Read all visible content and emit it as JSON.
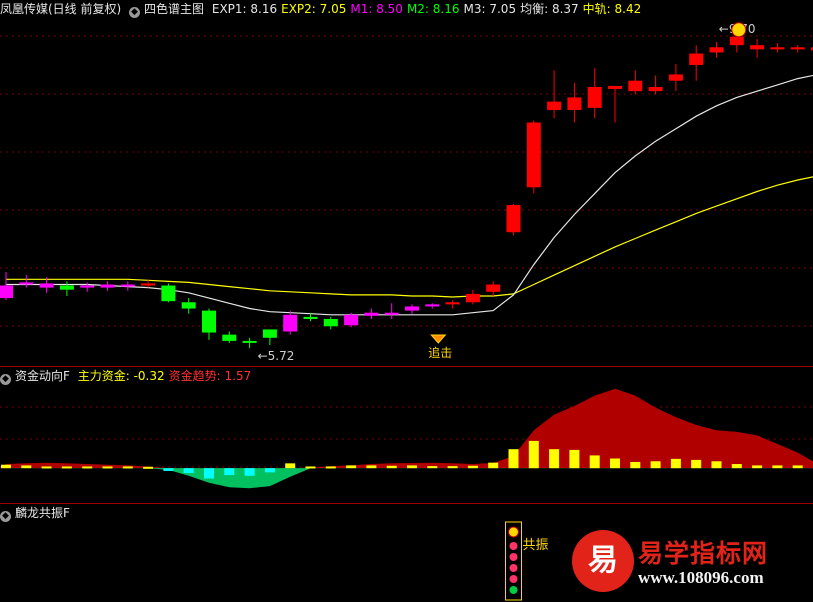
{
  "main_header": {
    "title": "凤凰传媒(日线 前复权)",
    "indicator_name": "四色谱主图",
    "items": [
      {
        "label": "EXP1: 8.16",
        "color": "#e6e6e6"
      },
      {
        "label": "EXP2: 7.05",
        "color": "#ffff00"
      },
      {
        "label": "M1: 8.50",
        "color": "#ff00ff"
      },
      {
        "label": "M2: 8.16",
        "color": "#00ff00"
      },
      {
        "label": "M3: 7.05",
        "color": "#e6e6e6"
      },
      {
        "label": "均衡: 8.37",
        "color": "#e6e6e6"
      },
      {
        "label": "中轨: 8.42",
        "color": "#ffff00"
      }
    ]
  },
  "money_header": {
    "title": "资金动向F",
    "items": [
      {
        "label": "主力资金: -0.32",
        "color": "#ffff00"
      },
      {
        "label": "资金趋势: 1.57",
        "color": "#ff3030"
      }
    ]
  },
  "resonance_header": {
    "title": "麟龙共振F"
  },
  "annotations": {
    "high_label": "9.70",
    "low_label": "5.72",
    "chase_label": "追击",
    "resonance_label": "共振"
  },
  "colors": {
    "up": "#ff0000",
    "down": "#00ff00",
    "magenta": "#ff00ff",
    "exp1": "#e6e6e6",
    "exp2": "#ffff00",
    "trend_fill": "#b00000",
    "money_pos": "#ffff00",
    "money_neg": "#00ffff",
    "money_area_neg": "#00c060"
  },
  "logo": {
    "title": "易学指标网",
    "url": "www.108096.com",
    "mark": "易"
  },
  "chart_data": [
    {
      "type": "candlestick",
      "title": "凤凰传媒(日线 前复权)",
      "candles": [
        {
          "o": 7.32,
          "h": 7.45,
          "l": 7.18,
          "c": 7.2,
          "color": "magenta"
        },
        {
          "o": 7.35,
          "h": 7.42,
          "l": 7.3,
          "c": 7.33,
          "color": "magenta"
        },
        {
          "o": 7.3,
          "h": 7.4,
          "l": 7.25,
          "c": 7.34,
          "color": "magenta"
        },
        {
          "o": 7.32,
          "h": 7.36,
          "l": 7.22,
          "c": 7.28,
          "color": "down"
        },
        {
          "o": 7.3,
          "h": 7.35,
          "l": 7.26,
          "c": 7.32,
          "color": "magenta"
        },
        {
          "o": 7.33,
          "h": 7.36,
          "l": 7.27,
          "c": 7.3,
          "color": "magenta"
        },
        {
          "o": 7.31,
          "h": 7.36,
          "l": 7.27,
          "c": 7.33,
          "color": "magenta"
        },
        {
          "o": 7.34,
          "h": 7.38,
          "l": 7.3,
          "c": 7.32,
          "color": "up"
        },
        {
          "o": 7.32,
          "h": 7.34,
          "l": 7.16,
          "c": 7.17,
          "color": "down"
        },
        {
          "o": 7.16,
          "h": 7.2,
          "l": 7.05,
          "c": 7.1,
          "color": "down"
        },
        {
          "o": 7.08,
          "h": 7.1,
          "l": 6.8,
          "c": 6.87,
          "color": "down"
        },
        {
          "o": 6.85,
          "h": 6.88,
          "l": 6.77,
          "c": 6.79,
          "color": "down"
        },
        {
          "o": 6.79,
          "h": 6.82,
          "l": 6.72,
          "c": 6.78,
          "color": "down"
        },
        {
          "o": 6.82,
          "h": 6.9,
          "l": 6.75,
          "c": 6.9,
          "color": "down"
        },
        {
          "o": 6.88,
          "h": 7.08,
          "l": 6.85,
          "c": 7.04,
          "color": "magenta"
        },
        {
          "o": 7.02,
          "h": 7.06,
          "l": 6.98,
          "c": 7.0,
          "color": "down"
        },
        {
          "o": 7.0,
          "h": 7.02,
          "l": 6.9,
          "c": 6.93,
          "color": "down"
        },
        {
          "o": 6.94,
          "h": 7.06,
          "l": 6.92,
          "c": 7.04,
          "color": "magenta"
        },
        {
          "o": 7.06,
          "h": 7.1,
          "l": 7.0,
          "c": 7.03,
          "color": "magenta"
        },
        {
          "o": 7.04,
          "h": 7.15,
          "l": 7.0,
          "c": 7.06,
          "color": "magenta"
        },
        {
          "o": 7.08,
          "h": 7.14,
          "l": 7.05,
          "c": 7.12,
          "color": "magenta"
        },
        {
          "o": 7.12,
          "h": 7.15,
          "l": 7.1,
          "c": 7.14,
          "color": "magenta"
        },
        {
          "o": 7.14,
          "h": 7.18,
          "l": 7.1,
          "c": 7.16,
          "color": "up"
        },
        {
          "o": 7.16,
          "h": 7.28,
          "l": 7.14,
          "c": 7.24,
          "color": "up"
        },
        {
          "o": 7.26,
          "h": 7.36,
          "l": 7.22,
          "c": 7.33,
          "color": "up"
        },
        {
          "o": 7.83,
          "h": 8.1,
          "l": 7.8,
          "c": 8.09,
          "color": "up"
        },
        {
          "o": 8.26,
          "h": 8.9,
          "l": 8.2,
          "c": 8.88,
          "color": "up"
        },
        {
          "o": 9.0,
          "h": 9.38,
          "l": 8.92,
          "c": 9.08,
          "color": "up"
        },
        {
          "o": 9.0,
          "h": 9.26,
          "l": 8.88,
          "c": 9.12,
          "color": "up"
        },
        {
          "o": 9.02,
          "h": 9.4,
          "l": 8.92,
          "c": 9.22,
          "color": "up"
        },
        {
          "o": 9.2,
          "h": 9.23,
          "l": 8.88,
          "c": 9.23,
          "color": "up"
        },
        {
          "o": 9.18,
          "h": 9.38,
          "l": 9.15,
          "c": 9.28,
          "color": "up"
        },
        {
          "o": 9.18,
          "h": 9.33,
          "l": 9.15,
          "c": 9.22,
          "color": "up"
        },
        {
          "o": 9.28,
          "h": 9.44,
          "l": 9.18,
          "c": 9.34,
          "color": "up"
        },
        {
          "o": 9.43,
          "h": 9.62,
          "l": 9.28,
          "c": 9.54,
          "color": "up"
        },
        {
          "o": 9.6,
          "h": 9.65,
          "l": 9.5,
          "c": 9.55,
          "color": "up"
        },
        {
          "o": 9.62,
          "h": 9.7,
          "l": 9.55,
          "c": 9.7,
          "color": "up"
        },
        {
          "o": 9.58,
          "h": 9.68,
          "l": 9.5,
          "c": 9.62,
          "color": "up"
        },
        {
          "o": 9.6,
          "h": 9.64,
          "l": 9.55,
          "c": 9.58,
          "color": "up"
        },
        {
          "o": 9.58,
          "h": 9.62,
          "l": 9.55,
          "c": 9.6,
          "color": "up"
        },
        {
          "o": 9.57,
          "h": 9.64,
          "l": 9.55,
          "c": 9.6,
          "color": "up"
        }
      ],
      "exp1": [
        7.33,
        7.33,
        7.33,
        7.33,
        7.33,
        7.32,
        7.31,
        7.3,
        7.28,
        7.25,
        7.2,
        7.15,
        7.1,
        7.07,
        7.06,
        7.05,
        7.04,
        7.04,
        7.04,
        7.04,
        7.04,
        7.04,
        7.04,
        7.06,
        7.08,
        7.23,
        7.52,
        7.78,
        8.0,
        8.2,
        8.4,
        8.56,
        8.7,
        8.82,
        8.94,
        9.04,
        9.12,
        9.18,
        9.24,
        9.3,
        9.34
      ],
      "exp2": [
        7.38,
        7.38,
        7.38,
        7.38,
        7.38,
        7.38,
        7.38,
        7.37,
        7.36,
        7.35,
        7.33,
        7.31,
        7.29,
        7.27,
        7.26,
        7.25,
        7.24,
        7.23,
        7.23,
        7.23,
        7.22,
        7.22,
        7.21,
        7.22,
        7.22,
        7.24,
        7.33,
        7.42,
        7.51,
        7.6,
        7.69,
        7.77,
        7.85,
        7.93,
        8.01,
        8.08,
        8.15,
        8.22,
        8.28,
        8.33,
        8.37
      ],
      "ylim": [
        6.55,
        9.88
      ]
    },
    {
      "type": "bar",
      "title": "资金动向F",
      "series": [
        {
          "name": "主力资金",
          "values": [
            0.1,
            0.08,
            0.05,
            0.05,
            0.05,
            0.05,
            0.05,
            0.04,
            -0.08,
            -0.14,
            -0.3,
            -0.2,
            -0.22,
            -0.12,
            0.14,
            0.05,
            0.05,
            0.08,
            0.08,
            0.07,
            0.08,
            0.06,
            0.06,
            0.07,
            0.16,
            0.55,
            0.79,
            0.55,
            0.53,
            0.37,
            0.28,
            0.18,
            0.2,
            0.27,
            0.24,
            0.2,
            0.12,
            0.08,
            0.08,
            0.08,
            -0.05
          ]
        },
        {
          "name": "资金趋势",
          "values": [
            0.12,
            0.14,
            0.16,
            0.14,
            0.12,
            0.1,
            0.08,
            0.05,
            -0.05,
            -0.22,
            -0.42,
            -0.55,
            -0.58,
            -0.52,
            -0.25,
            0.02,
            0.06,
            0.08,
            0.12,
            0.14,
            0.15,
            0.16,
            0.14,
            0.12,
            0.15,
            0.35,
            1.1,
            1.55,
            1.8,
            2.1,
            2.3,
            2.1,
            1.75,
            1.48,
            1.25,
            1.1,
            1.05,
            0.95,
            0.7,
            0.45,
            0.12
          ]
        }
      ],
      "ylim": [
        -0.95,
        2.35
      ]
    },
    {
      "type": "scatter",
      "title": "麟龙共振F",
      "signal_bar_index": 25
    }
  ]
}
